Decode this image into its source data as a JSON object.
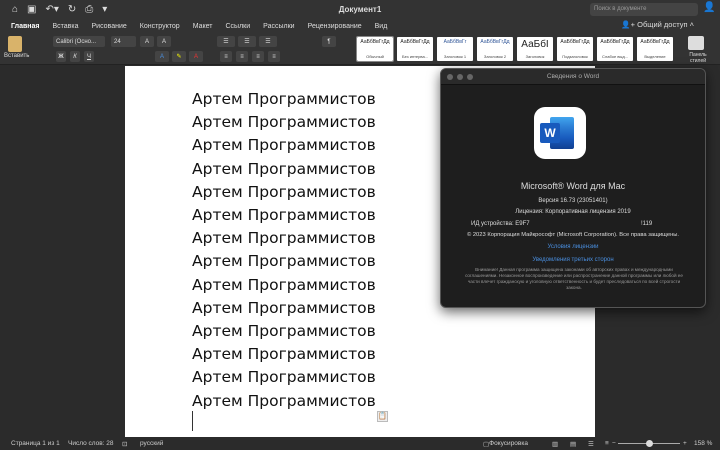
{
  "window": {
    "title": "Документ1",
    "search_placeholder": "Поиск в документе"
  },
  "quick_access": {
    "icons": [
      "home-icon",
      "save-icon",
      "undo-icon",
      "redo-icon",
      "print-icon",
      "customize-icon"
    ]
  },
  "tabs": [
    "Главная",
    "Вставка",
    "Рисование",
    "Конструктор",
    "Макет",
    "Ссылки",
    "Рассылки",
    "Рецензирование",
    "Вид"
  ],
  "active_tab": "Главная",
  "share_label": "Общий доступ",
  "ribbon": {
    "paste_label": "Вставить",
    "font_name": "Calibri (Осно...",
    "font_size": "24",
    "styles_pane_label": "Панель стилей",
    "styles": [
      {
        "preview": "АаБбВвГгДд",
        "name": "Обычный"
      },
      {
        "preview": "АаБбВвГгДд",
        "name": "Без интерва..."
      },
      {
        "preview": "АаБбВвГг",
        "name": "Заголовок 1"
      },
      {
        "preview": "АаБбВвГгДд",
        "name": "Заголовок 2"
      },
      {
        "preview": "АаБбІ",
        "name": "Заголовок"
      },
      {
        "preview": "АаБбВвГгДд",
        "name": "Подзаголовок"
      },
      {
        "preview": "АаБбВвГгДд",
        "name": "Слабое выд..."
      },
      {
        "preview": "АаБбВвГгДд",
        "name": "Выделение"
      }
    ]
  },
  "document": {
    "lines": [
      "Артем Программистов",
      "Артем Программистов",
      "Артем Программистов",
      "Артем Программистов",
      "Артем Программистов",
      "Артем Программистов",
      "Артем Программистов",
      "Артем Программистов",
      "Артем Программистов",
      "Артем Программистов",
      "Артем Программистов",
      "Артем Программистов",
      "Артем Программистов",
      "Артем Программистов"
    ]
  },
  "about": {
    "title": "Сведения о Word",
    "product": "Microsoft® Word для Mac",
    "version": "Версия 16.73 (23051401)",
    "license": "Лицензия: Корпоративная лицензия 2019",
    "device_id": "ИД устройства: E9F7",
    "device_id_end": "!119",
    "copyright": "© 2023 Корпорация Майкрософт (Microsoft Corporation). Все права защищены.",
    "license_terms": "Условия лицензии",
    "third_party": "Уведомления третьих сторон",
    "warning": "Внимание! Данная программа защищена законами об авторских правах и международными соглашениями. Незаконное воспроизведение или распространение данной программы или любой ее части влечет гражданскую и уголовную ответственность и будет преследоваться по всей строгости закона."
  },
  "status": {
    "page": "Страница 1 из 1",
    "words": "Число слов: 28",
    "language": "русский",
    "focus": "Фокусировка",
    "zoom": "158 %"
  },
  "colors": {
    "accent": "#185abd",
    "link": "#4a8fe0"
  }
}
